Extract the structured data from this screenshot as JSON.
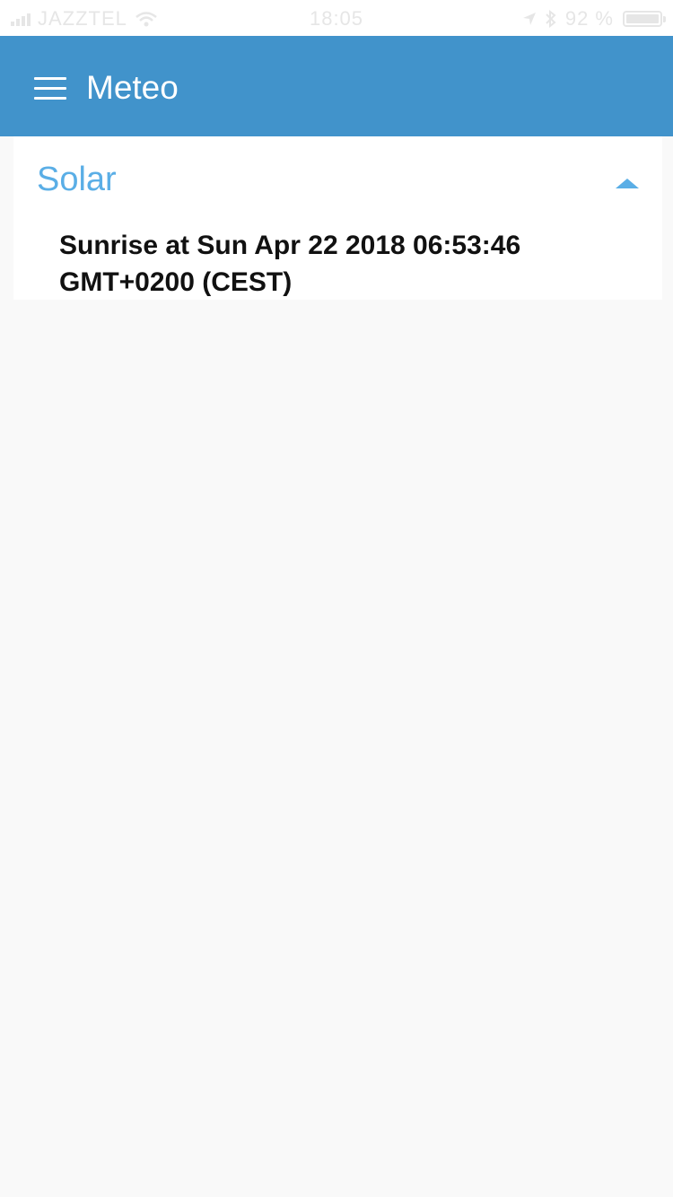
{
  "status_bar": {
    "carrier": "JAZZTEL",
    "time": "18:05",
    "battery": "92 %",
    "battery_level": 0.92
  },
  "app_bar": {
    "title": "Meteo",
    "menu_icon": "hamburger-menu-icon"
  },
  "solar_card": {
    "title": "Solar",
    "toggle_icon": "chevron-up-icon",
    "sunrise_text": "Sunrise at Sun Apr 22 2018 06:53:46 GMT+0200 (CEST)"
  },
  "colors": {
    "app_bar": "#4193cb",
    "accent": "#5aaee6",
    "background": "#f9f9f9"
  }
}
